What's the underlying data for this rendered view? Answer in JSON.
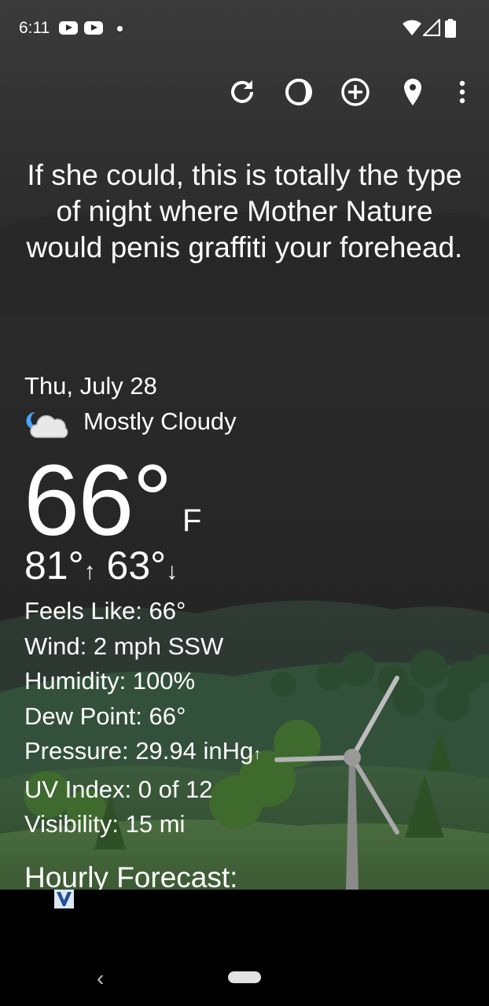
{
  "status": {
    "time": "6:11"
  },
  "toolbar": {
    "buttons": [
      "refresh-icon",
      "theme-icon",
      "add-icon",
      "location-pin-icon",
      "more-vert-icon"
    ]
  },
  "quote": "If she could, this is totally the type of night where Mother Nature would penis graffiti your forehead.",
  "weather": {
    "date": "Thu, July 28",
    "condition": "Mostly Cloudy",
    "condition_icon": "moon-cloud-icon",
    "temperature": "66°",
    "unit": "F",
    "high": "81°",
    "low": "63°",
    "details": {
      "feels_like": "Feels Like:  66°",
      "wind": "Wind:  2 mph SSW",
      "humidity": "Humidity:  100%",
      "dew_point": "Dew Point:  66°",
      "pressure": "Pressure:  29.94 inHg",
      "uv_index": "UV Index:  0 of 12",
      "visibility": "Visibility:  15 mi"
    },
    "hourly_heading": "Hourly Forecast:"
  },
  "colors": {
    "background": "#2a2a2a",
    "hills": "#3a4a40",
    "text": "#ffffff",
    "navbar": "#000000"
  }
}
